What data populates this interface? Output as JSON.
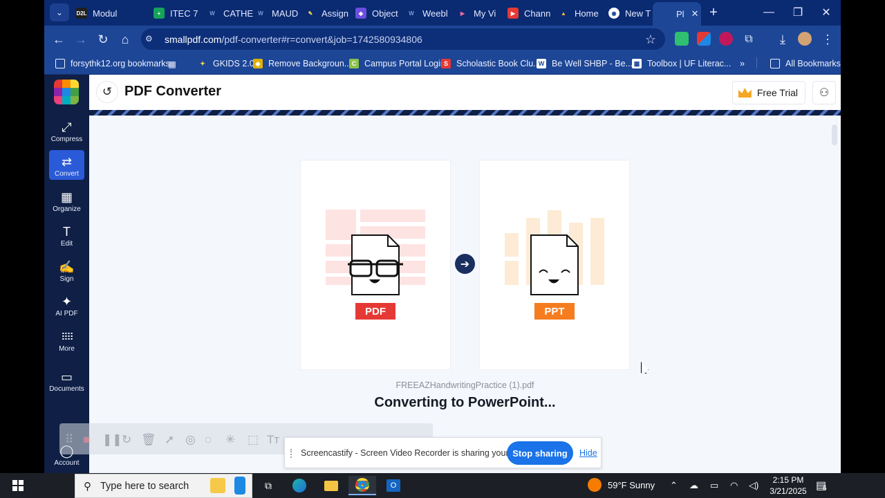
{
  "tabs": [
    {
      "label": "Modul",
      "fav": "D2L",
      "color": "#1f1f1f"
    },
    {
      "label": "ITEC 7",
      "fav": "+",
      "color": "#16a35a"
    },
    {
      "label": "CATHE",
      "fav": "W",
      "color": "#1d4696"
    },
    {
      "label": "MAUD",
      "fav": "W",
      "color": "#1d4696"
    },
    {
      "label": "Assign",
      "fav": "✎",
      "color": "#1d4696"
    },
    {
      "label": "Object",
      "fav": "◆",
      "color": "#6c4fe0"
    },
    {
      "label": "Weebl",
      "fav": "W",
      "color": "#1d4696"
    },
    {
      "label": "My Vi",
      "fav": "▶",
      "color": "#c2185b"
    },
    {
      "label": "Chann",
      "fav": "▶",
      "color": "#e53935"
    },
    {
      "label": "Home",
      "fav": "▲",
      "color": "#1e88e5"
    },
    {
      "label": "New T",
      "fav": "◉",
      "color": "#1d4696"
    },
    {
      "label": "Pl",
      "fav": "",
      "color": "#1d4696"
    }
  ],
  "url": {
    "host": "smallpdf.com",
    "path": "/pdf-converter#r=convert&job=1742580934806"
  },
  "bookmarks": [
    {
      "label": "forsythk12.org bookmarks",
      "fav": "▭",
      "color": "#1d4696"
    },
    {
      "label": "GKIDS 2.0",
      "fav": "✦",
      "color": "#1d4696"
    },
    {
      "label": "Remove Backgroun...",
      "fav": "◆",
      "color": "#e0b000"
    },
    {
      "label": "Campus Portal Login",
      "fav": "C",
      "color": "#8bc34a"
    },
    {
      "label": "Scholastic Book Clu...",
      "fav": "S",
      "color": "#e53935"
    },
    {
      "label": "Be Well SHBP - Be...",
      "fav": "W",
      "color": "#ffffff"
    },
    {
      "label": "Toolbox | UF Literac...",
      "fav": "▦",
      "color": "#ffffff"
    }
  ],
  "all_bookmarks": "All Bookmarks",
  "sidebar": [
    {
      "label": "Compress",
      "icon": "⤢"
    },
    {
      "label": "Convert",
      "icon": "⇄"
    },
    {
      "label": "Organize",
      "icon": "▦"
    },
    {
      "label": "Edit",
      "icon": "T"
    },
    {
      "label": "Sign",
      "icon": "✍"
    },
    {
      "label": "AI PDF",
      "icon": "✦"
    },
    {
      "label": "More",
      "icon": "⋮⋮"
    },
    {
      "label": "Documents",
      "icon": "▭"
    },
    {
      "label": "Account",
      "icon": "●"
    }
  ],
  "header": {
    "title": "PDF Converter",
    "trial": "Free Trial"
  },
  "conversion": {
    "from": "PDF",
    "to": "PPT",
    "from_color": "#e53935",
    "to_color": "#f57c1f",
    "filename": "FREEAZHandwritingPractice (1).pdf",
    "status": "Converting to PowerPoint..."
  },
  "share": {
    "text": "Screencastify - Screen Video Recorder is sharing your screen.",
    "stop": "Stop sharing",
    "hide": "Hide"
  },
  "taskbar": {
    "search_placeholder": "Type here to search",
    "weather": "59°F Sunny",
    "time": "2:15 PM",
    "date": "3/21/2025",
    "notifications": "6"
  }
}
